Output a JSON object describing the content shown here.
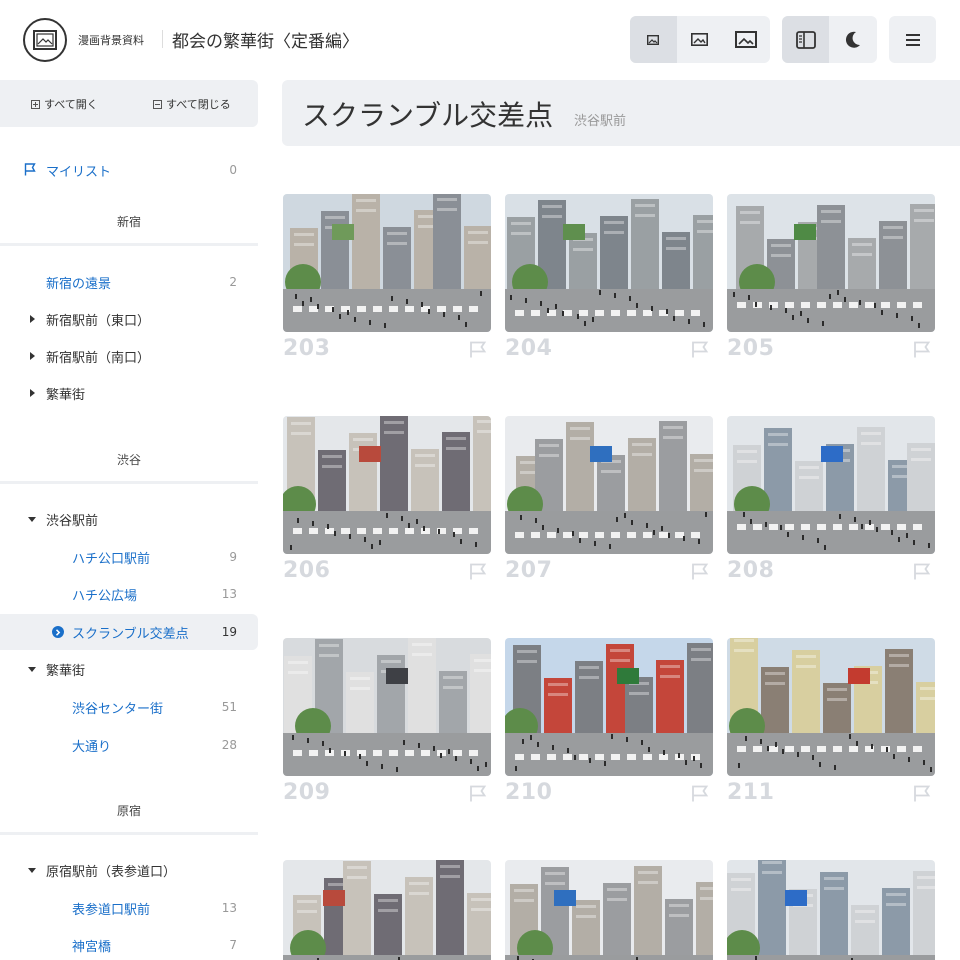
{
  "header": {
    "site_name": "漫画背景資料",
    "page_heading": "都会の繁華街〈定番編〉",
    "icons": {
      "logo": "image-frame-icon",
      "size_small": "image-small-icon",
      "size_medium": "image-medium-icon",
      "size_large": "image-large-icon",
      "sidebar_toggle": "sidebar-icon",
      "dark_mode": "moon-icon",
      "menu": "hamburger-icon"
    }
  },
  "sidebar": {
    "expand_all": "すべて開く",
    "collapse_all": "すべて閉じる",
    "mylist": {
      "label": "マイリスト",
      "count": "0"
    },
    "sections": [
      {
        "title": "新宿",
        "items": [
          {
            "label": "新宿の遠景",
            "count": "2"
          },
          {
            "label": "新宿駅前（東口）"
          },
          {
            "label": "新宿駅前（南口）"
          },
          {
            "label": "繁華街"
          }
        ]
      },
      {
        "title": "渋谷",
        "items": [
          {
            "label": "渋谷駅前"
          },
          {
            "label": "ハチ公口駅前",
            "count": "9"
          },
          {
            "label": "ハチ公広場",
            "count": "13"
          },
          {
            "label": "スクランブル交差点",
            "count": "19"
          },
          {
            "label": "繁華街"
          },
          {
            "label": "渋谷センター街",
            "count": "51"
          },
          {
            "label": "大通り",
            "count": "28"
          }
        ]
      },
      {
        "title": "原宿",
        "items": [
          {
            "label": "原宿駅前（表参道口）"
          },
          {
            "label": "表参道口駅前",
            "count": "13"
          },
          {
            "label": "神宮橋",
            "count": "7"
          }
        ]
      }
    ]
  },
  "main": {
    "title": "スクランブル交差点",
    "subtitle": "渋谷駅前",
    "cards": [
      "203",
      "204",
      "205",
      "206",
      "207",
      "208",
      "209",
      "210",
      "211"
    ]
  },
  "colors": {
    "accent": "#1a6fc9",
    "panel": "#eef0f3",
    "number": "#d6d9de"
  }
}
